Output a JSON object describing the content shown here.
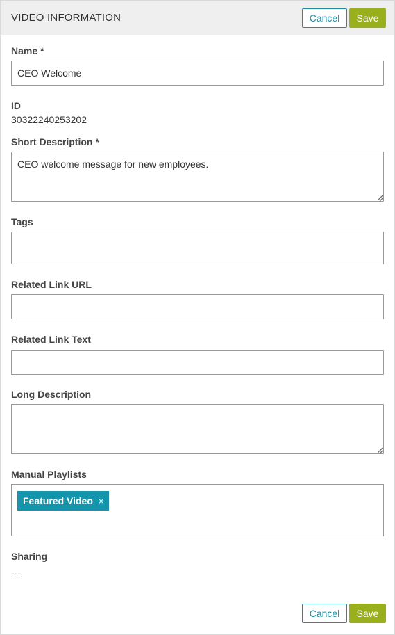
{
  "header": {
    "title": "VIDEO INFORMATION",
    "cancel_label": "Cancel",
    "save_label": "Save"
  },
  "fields": {
    "name": {
      "label": "Name *",
      "value": "CEO Welcome"
    },
    "id": {
      "label": "ID",
      "value": "30322240253202"
    },
    "short_description": {
      "label": "Short Description *",
      "value": "CEO welcome message for new employees."
    },
    "tags": {
      "label": "Tags",
      "value": ""
    },
    "related_link_url": {
      "label": "Related Link URL",
      "value": ""
    },
    "related_link_text": {
      "label": "Related Link Text",
      "value": ""
    },
    "long_description": {
      "label": "Long Description",
      "value": ""
    },
    "manual_playlists": {
      "label": "Manual Playlists",
      "items": [
        {
          "label": "Featured Video",
          "remove_glyph": "×"
        }
      ]
    },
    "sharing": {
      "label": "Sharing",
      "value": "---"
    }
  },
  "footer": {
    "cancel_label": "Cancel",
    "save_label": "Save"
  },
  "colors": {
    "accent": "#1595ab",
    "save": "#9aaf1c",
    "header_bg": "#efefef"
  }
}
